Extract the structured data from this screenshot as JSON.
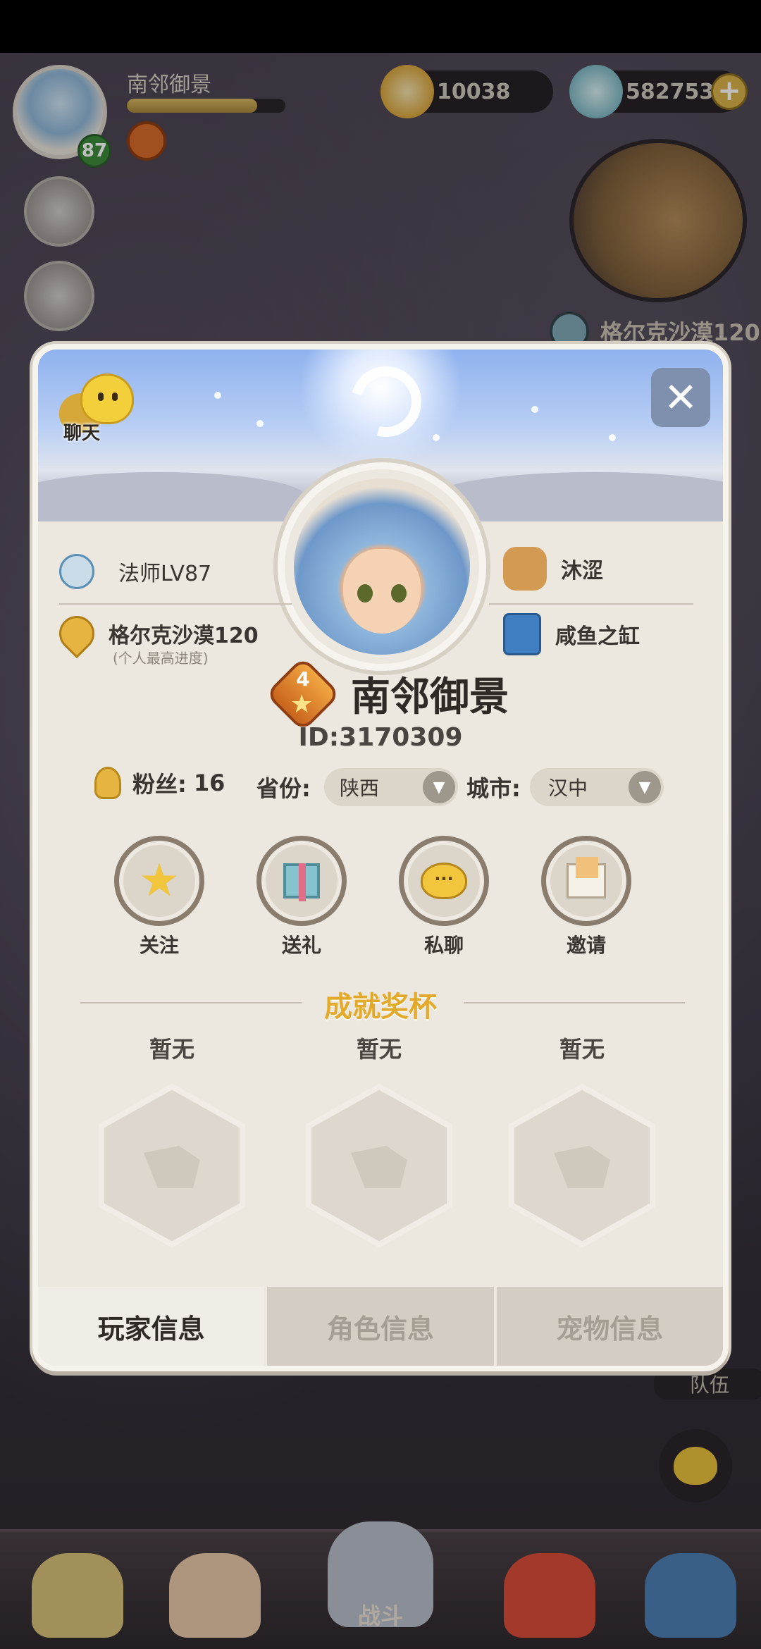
{
  "hud": {
    "player_name": "南邻御景",
    "level": "87",
    "exp_fraction": 0.82,
    "currency_shells": "10038",
    "currency_gems": "582753",
    "map_location": "格尔克沙漠120",
    "team_label": "队伍",
    "battle_label": "战斗"
  },
  "panel": {
    "chat_label": "聊天",
    "class_level": "法师LV87",
    "progress_location": "格尔克沙漠120",
    "progress_note": "(个人最高进度)",
    "partner_name": "沐涩",
    "guild_name": "咸鱼之缸",
    "rank_number": "4",
    "player_name": "南邻御景",
    "player_id": "ID:3170309",
    "fans_label": "粉丝:",
    "fans_count": "16",
    "province_label": "省份:",
    "province_value": "陕西",
    "city_label": "城市:",
    "city_value": "汉中",
    "actions": [
      {
        "label": "关注"
      },
      {
        "label": "送礼"
      },
      {
        "label": "私聊"
      },
      {
        "label": "邀请"
      }
    ],
    "trophy_title": "成就奖杯",
    "trophies": [
      {
        "label": "暂无"
      },
      {
        "label": "暂无"
      },
      {
        "label": "暂无"
      }
    ],
    "tabs": [
      {
        "label": "玩家信息"
      },
      {
        "label": "角色信息"
      },
      {
        "label": "宠物信息"
      }
    ]
  },
  "colors": {
    "accent_gold": "#e3a92a",
    "panel_bg": "#ece7df",
    "level_green": "#3c8a3a"
  }
}
